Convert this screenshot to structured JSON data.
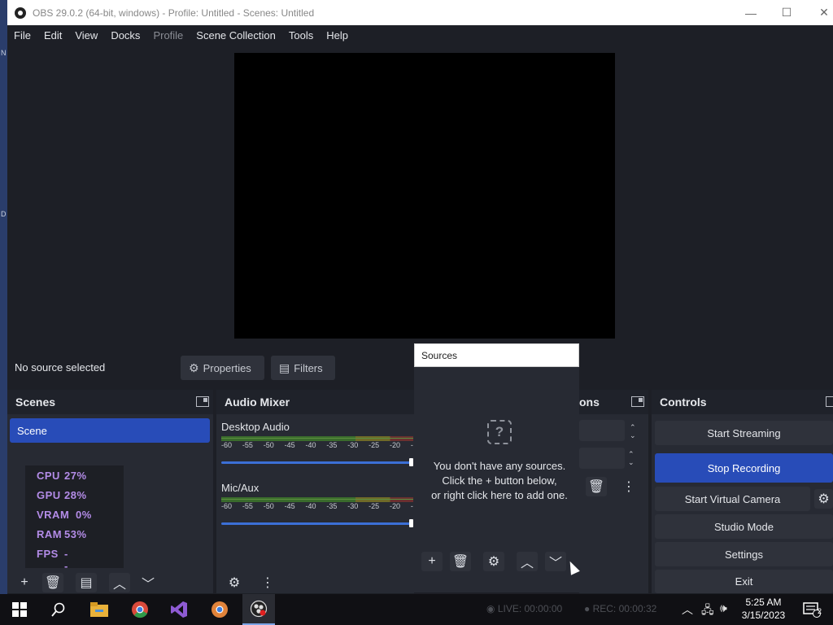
{
  "window": {
    "title": "OBS 29.0.2 (64-bit, windows) - Profile: Untitled - Scenes: Untitled",
    "minimize": "—",
    "maximize": "☐",
    "close": "✕"
  },
  "desktop": {
    "marks": [
      "N",
      "D"
    ]
  },
  "menu": {
    "file": "File",
    "edit": "Edit",
    "view": "View",
    "docks": "Docks",
    "profile": "Profile",
    "scene_collection": "Scene Collection",
    "tools": "Tools",
    "help": "Help"
  },
  "source_bar": {
    "status": "No source selected",
    "properties": "Properties",
    "filters": "Filters"
  },
  "scenes": {
    "title": "Scenes",
    "items": [
      "Scene"
    ]
  },
  "stats": {
    "cpu_label": "CPU",
    "cpu_value": "27%",
    "gpu_label": "GPU",
    "gpu_value": "28%",
    "vram_label": "VRAM",
    "vram_value": "0%",
    "ram_label": "RAM",
    "ram_value": "53%",
    "fps_label": "FPS",
    "fps_value": "--"
  },
  "audio_mixer": {
    "title": "Audio Mixer",
    "scale": [
      "-60",
      "-55",
      "-50",
      "-45",
      "-40",
      "-35",
      "-30",
      "-25",
      "-20",
      "-"
    ],
    "channels": [
      {
        "name": "Desktop Audio",
        "volume": 1.0
      },
      {
        "name": "Mic/Aux",
        "volume": 1.0
      }
    ]
  },
  "transitions": {
    "title_fragment": "ons"
  },
  "sources": {
    "title": "Sources",
    "empty_line1": "You don't have any sources.",
    "empty_line2": "Click the + button below,",
    "empty_line3": "or right click here to add one."
  },
  "controls": {
    "title": "Controls",
    "start_streaming": "Start Streaming",
    "stop_recording": "Stop Recording",
    "start_virtual_camera": "Start Virtual Camera",
    "studio_mode": "Studio Mode",
    "settings": "Settings",
    "exit": "Exit"
  },
  "statusbar": {
    "live": "LIVE: 00:00:00",
    "rec": "REC: 00:00:32"
  },
  "taskbar": {
    "time": "5:25 AM",
    "date": "3/15/2023",
    "notifications": "2"
  },
  "colors": {
    "accent": "#284cb8",
    "panel": "#272a33",
    "background": "#1d1f26"
  }
}
